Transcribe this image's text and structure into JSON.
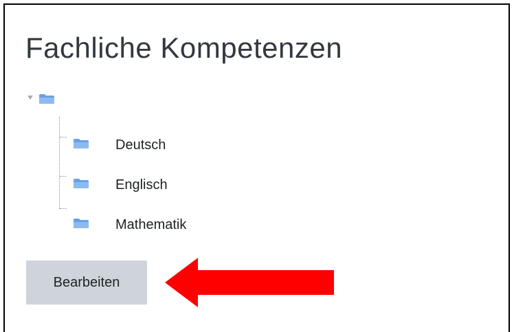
{
  "page": {
    "title": "Fachliche Kompetenzen"
  },
  "tree": {
    "root": {
      "expanded": true,
      "label": ""
    },
    "children": [
      {
        "label": "Deutsch"
      },
      {
        "label": "Englisch"
      },
      {
        "label": "Mathematik"
      }
    ]
  },
  "actions": {
    "edit_label": "Bearbeiten"
  },
  "annotation": {
    "arrow_color": "#ff0000",
    "direction": "left"
  },
  "colors": {
    "folder": "#6aa0e4",
    "button_bg": "#ced4da"
  }
}
